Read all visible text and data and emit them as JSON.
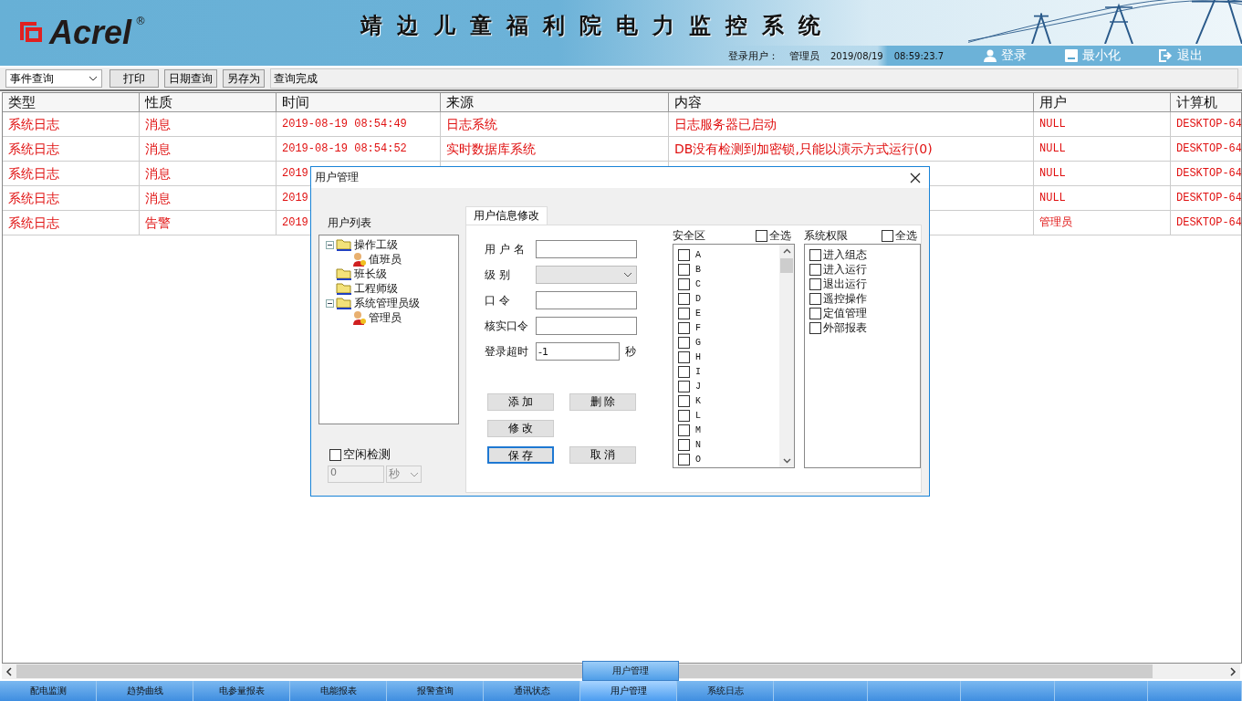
{
  "header": {
    "logo_text": "Acrel",
    "logo_mark": "®",
    "title": "靖边儿童福利院电力监控系统",
    "user_label": "登录用户：",
    "user": "管理员",
    "date": "2019/08/19",
    "time": "08:59:23.7",
    "actions": [
      {
        "kind": "login",
        "label": "登录"
      },
      {
        "kind": "minimize",
        "label": "最小化"
      },
      {
        "kind": "exit",
        "label": "退出"
      }
    ]
  },
  "toolbar": {
    "query_type": "事件查询",
    "buttons": [
      "打印",
      "日期查询",
      "另存为"
    ],
    "status": "查询完成"
  },
  "table": {
    "columns": [
      "类型",
      "性质",
      "时间",
      "来源",
      "内容",
      "用户",
      "计算机"
    ],
    "rows": [
      {
        "cells": [
          "系统日志",
          "消息",
          "2019-08-19 08:54:49",
          "日志系统",
          "日志服务器已启动",
          "NULL",
          "DESKTOP-64"
        ]
      },
      {
        "cells": [
          "系统日志",
          "消息",
          "2019-08-19 08:54:52",
          "实时数据库系统",
          "DB没有检测到加密锁,只能以演示方式运行(0)",
          "NULL",
          "DESKTOP-64"
        ]
      },
      {
        "cells": [
          "系统日志",
          "消息",
          "2019",
          null,
          null,
          "NULL",
          "DESKTOP-64"
        ]
      },
      {
        "cells": [
          "系统日志",
          "消息",
          "2019",
          null,
          null,
          "NULL",
          "DESKTOP-64"
        ]
      },
      {
        "cells": [
          "系统日志",
          "告警",
          "2019",
          null,
          null,
          "管理员",
          "DESKTOP-64"
        ]
      }
    ]
  },
  "dialog": {
    "title": "用户管理",
    "user_list_label": "用户列表",
    "tree": [
      {
        "label": "操作工级",
        "kind": "group",
        "expanded": true,
        "children": [
          {
            "label": "值班员",
            "kind": "user"
          }
        ]
      },
      {
        "label": "班长级",
        "kind": "group"
      },
      {
        "label": "工程师级",
        "kind": "group"
      },
      {
        "label": "系统管理员级",
        "kind": "group",
        "expanded": true,
        "children": [
          {
            "label": "管理员",
            "kind": "user"
          }
        ]
      }
    ],
    "idle_check": {
      "label": "空闲检测",
      "checked": false,
      "value": "0",
      "unit": "秒"
    },
    "tab": {
      "label": "用户信息修改",
      "selected": true
    },
    "form": [
      {
        "kind": "text",
        "label": "用 户 名"
      },
      {
        "kind": "select",
        "label": "级 别"
      },
      {
        "kind": "text",
        "label": "口 令"
      },
      {
        "kind": "text",
        "label": "核实口令"
      },
      {
        "kind": "unit",
        "label": "登录超时",
        "value": "-1",
        "unit": "秒"
      }
    ],
    "buttons": [
      {
        "label": "添 加",
        "focused": false
      },
      {
        "label": "删 除",
        "focused": false
      },
      {
        "label": "修 改",
        "focused": false
      },
      {
        "label": "保 存",
        "focused": true
      },
      {
        "label": "取 消",
        "focused": false
      }
    ],
    "zones": {
      "label": "安全区",
      "select_all": {
        "label": "全选",
        "checked": false
      },
      "items": [
        {
          "label": "A",
          "checked": false
        },
        {
          "label": "B",
          "checked": false
        },
        {
          "label": "C",
          "checked": false
        },
        {
          "label": "D",
          "checked": false
        },
        {
          "label": "E",
          "checked": false
        },
        {
          "label": "F",
          "checked": false
        },
        {
          "label": "G",
          "checked": false
        },
        {
          "label": "H",
          "checked": false
        },
        {
          "label": "I",
          "checked": false
        },
        {
          "label": "J",
          "checked": false
        },
        {
          "label": "K",
          "checked": false
        },
        {
          "label": "L",
          "checked": false
        },
        {
          "label": "M",
          "checked": false
        },
        {
          "label": "N",
          "checked": false
        },
        {
          "label": "O",
          "checked": false
        }
      ]
    },
    "permissions": {
      "label": "系统权限",
      "select_all": {
        "label": "全选",
        "checked": false
      },
      "items": [
        {
          "label": "进入组态",
          "checked": false
        },
        {
          "label": "进入运行",
          "checked": false
        },
        {
          "label": "退出运行",
          "checked": false
        },
        {
          "label": "遥控操作",
          "checked": false
        },
        {
          "label": "定值管理",
          "checked": false
        },
        {
          "label": "外部报表",
          "checked": false
        }
      ]
    }
  },
  "tab_popup": "用户管理",
  "bottom_tabs": [
    {
      "label": "配电监测",
      "selected": false
    },
    {
      "label": "趋势曲线",
      "selected": false
    },
    {
      "label": "电参量报表",
      "selected": false
    },
    {
      "label": "电能报表",
      "selected": false
    },
    {
      "label": "报警查询",
      "selected": false
    },
    {
      "label": "通讯状态",
      "selected": false
    },
    {
      "label": "用户管理",
      "selected": true
    },
    {
      "label": "系统日志",
      "selected": false
    }
  ]
}
